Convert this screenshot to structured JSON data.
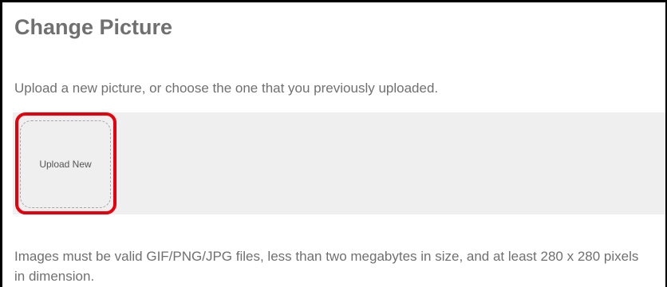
{
  "page": {
    "title": "Change Picture",
    "subtitle": "Upload a new picture, or choose the one that you previously uploaded."
  },
  "upload": {
    "button_label": "Upload New",
    "highlight_color": "#e6000d"
  },
  "footer": {
    "note": "Images must be valid GIF/PNG/JPG files, less than two megabytes in size, and at least 280 x 280 pixels in dimension."
  }
}
